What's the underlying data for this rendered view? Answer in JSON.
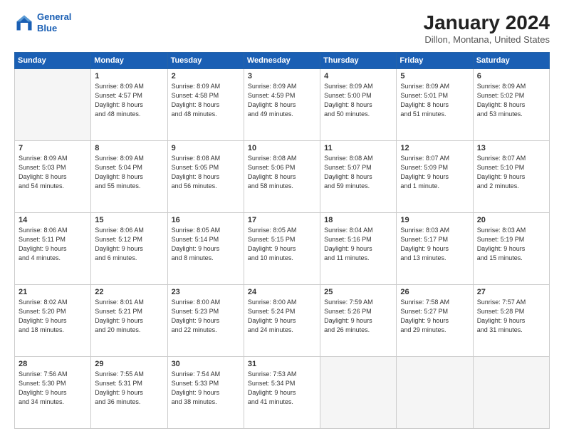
{
  "header": {
    "logo_line1": "General",
    "logo_line2": "Blue",
    "main_title": "January 2024",
    "subtitle": "Dillon, Montana, United States"
  },
  "weekdays": [
    "Sunday",
    "Monday",
    "Tuesday",
    "Wednesday",
    "Thursday",
    "Friday",
    "Saturday"
  ],
  "weeks": [
    [
      {
        "day": "",
        "info": ""
      },
      {
        "day": "1",
        "info": "Sunrise: 8:09 AM\nSunset: 4:57 PM\nDaylight: 8 hours\nand 48 minutes."
      },
      {
        "day": "2",
        "info": "Sunrise: 8:09 AM\nSunset: 4:58 PM\nDaylight: 8 hours\nand 48 minutes."
      },
      {
        "day": "3",
        "info": "Sunrise: 8:09 AM\nSunset: 4:59 PM\nDaylight: 8 hours\nand 49 minutes."
      },
      {
        "day": "4",
        "info": "Sunrise: 8:09 AM\nSunset: 5:00 PM\nDaylight: 8 hours\nand 50 minutes."
      },
      {
        "day": "5",
        "info": "Sunrise: 8:09 AM\nSunset: 5:01 PM\nDaylight: 8 hours\nand 51 minutes."
      },
      {
        "day": "6",
        "info": "Sunrise: 8:09 AM\nSunset: 5:02 PM\nDaylight: 8 hours\nand 53 minutes."
      }
    ],
    [
      {
        "day": "7",
        "info": "Sunrise: 8:09 AM\nSunset: 5:03 PM\nDaylight: 8 hours\nand 54 minutes."
      },
      {
        "day": "8",
        "info": "Sunrise: 8:09 AM\nSunset: 5:04 PM\nDaylight: 8 hours\nand 55 minutes."
      },
      {
        "day": "9",
        "info": "Sunrise: 8:08 AM\nSunset: 5:05 PM\nDaylight: 8 hours\nand 56 minutes."
      },
      {
        "day": "10",
        "info": "Sunrise: 8:08 AM\nSunset: 5:06 PM\nDaylight: 8 hours\nand 58 minutes."
      },
      {
        "day": "11",
        "info": "Sunrise: 8:08 AM\nSunset: 5:07 PM\nDaylight: 8 hours\nand 59 minutes."
      },
      {
        "day": "12",
        "info": "Sunrise: 8:07 AM\nSunset: 5:09 PM\nDaylight: 9 hours\nand 1 minute."
      },
      {
        "day": "13",
        "info": "Sunrise: 8:07 AM\nSunset: 5:10 PM\nDaylight: 9 hours\nand 2 minutes."
      }
    ],
    [
      {
        "day": "14",
        "info": "Sunrise: 8:06 AM\nSunset: 5:11 PM\nDaylight: 9 hours\nand 4 minutes."
      },
      {
        "day": "15",
        "info": "Sunrise: 8:06 AM\nSunset: 5:12 PM\nDaylight: 9 hours\nand 6 minutes."
      },
      {
        "day": "16",
        "info": "Sunrise: 8:05 AM\nSunset: 5:14 PM\nDaylight: 9 hours\nand 8 minutes."
      },
      {
        "day": "17",
        "info": "Sunrise: 8:05 AM\nSunset: 5:15 PM\nDaylight: 9 hours\nand 10 minutes."
      },
      {
        "day": "18",
        "info": "Sunrise: 8:04 AM\nSunset: 5:16 PM\nDaylight: 9 hours\nand 11 minutes."
      },
      {
        "day": "19",
        "info": "Sunrise: 8:03 AM\nSunset: 5:17 PM\nDaylight: 9 hours\nand 13 minutes."
      },
      {
        "day": "20",
        "info": "Sunrise: 8:03 AM\nSunset: 5:19 PM\nDaylight: 9 hours\nand 15 minutes."
      }
    ],
    [
      {
        "day": "21",
        "info": "Sunrise: 8:02 AM\nSunset: 5:20 PM\nDaylight: 9 hours\nand 18 minutes."
      },
      {
        "day": "22",
        "info": "Sunrise: 8:01 AM\nSunset: 5:21 PM\nDaylight: 9 hours\nand 20 minutes."
      },
      {
        "day": "23",
        "info": "Sunrise: 8:00 AM\nSunset: 5:23 PM\nDaylight: 9 hours\nand 22 minutes."
      },
      {
        "day": "24",
        "info": "Sunrise: 8:00 AM\nSunset: 5:24 PM\nDaylight: 9 hours\nand 24 minutes."
      },
      {
        "day": "25",
        "info": "Sunrise: 7:59 AM\nSunset: 5:26 PM\nDaylight: 9 hours\nand 26 minutes."
      },
      {
        "day": "26",
        "info": "Sunrise: 7:58 AM\nSunset: 5:27 PM\nDaylight: 9 hours\nand 29 minutes."
      },
      {
        "day": "27",
        "info": "Sunrise: 7:57 AM\nSunset: 5:28 PM\nDaylight: 9 hours\nand 31 minutes."
      }
    ],
    [
      {
        "day": "28",
        "info": "Sunrise: 7:56 AM\nSunset: 5:30 PM\nDaylight: 9 hours\nand 34 minutes."
      },
      {
        "day": "29",
        "info": "Sunrise: 7:55 AM\nSunset: 5:31 PM\nDaylight: 9 hours\nand 36 minutes."
      },
      {
        "day": "30",
        "info": "Sunrise: 7:54 AM\nSunset: 5:33 PM\nDaylight: 9 hours\nand 38 minutes."
      },
      {
        "day": "31",
        "info": "Sunrise: 7:53 AM\nSunset: 5:34 PM\nDaylight: 9 hours\nand 41 minutes."
      },
      {
        "day": "",
        "info": ""
      },
      {
        "day": "",
        "info": ""
      },
      {
        "day": "",
        "info": ""
      }
    ]
  ]
}
